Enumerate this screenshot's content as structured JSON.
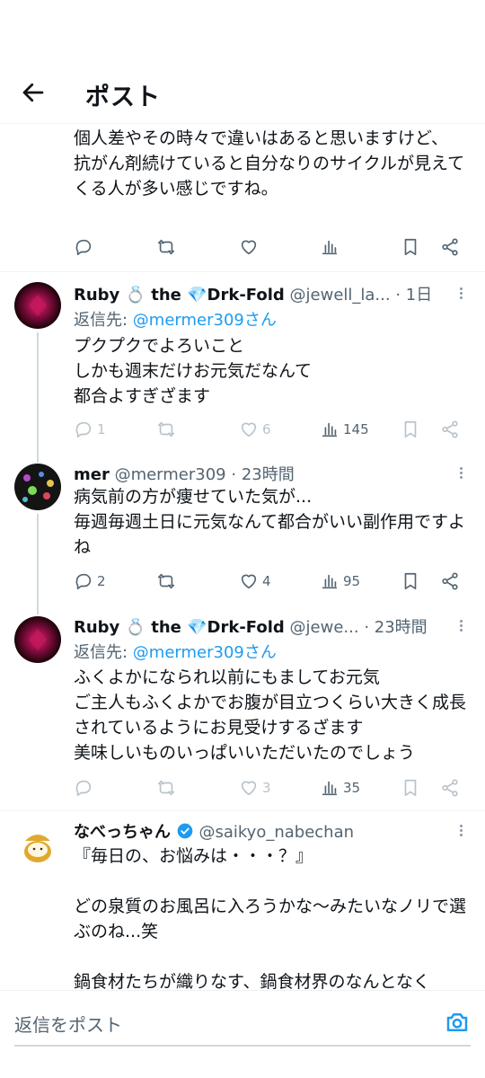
{
  "header": {
    "title": "ポスト"
  },
  "posts": [
    {
      "body": "個人差やその時々で違いはあると思いますけど、\n抗がん剤続けていると自分なりのサイクルが見えてくる人が多い感じですね。",
      "counts": {
        "reply": "",
        "repost": "",
        "like": "",
        "views": ""
      }
    },
    {
      "name": "Ruby 💍 the 💎Drk-Fold",
      "handle": "@jewell_la...",
      "time": "· 1日",
      "reply_prefix": "返信先: ",
      "reply_mention": "@mermer309さん",
      "body": "プクプクでよろいこと\nしかも週末だけお元気だなんて\n都合よすぎざます",
      "counts": {
        "reply": "1",
        "repost": "",
        "like": "6",
        "views": "145"
      }
    },
    {
      "name": "mer",
      "handle": "@mermer309",
      "time": "· 23時間",
      "body": "病気前の方が痩せていた気が...\n毎週毎週土日に元気なんて都合がいい副作用ですよね",
      "counts": {
        "reply": "2",
        "repost": "",
        "like": "4",
        "views": "95"
      }
    },
    {
      "name": "Ruby 💍 the 💎Drk-Fold",
      "handle": "@jewe...",
      "time": "· 23時間",
      "reply_prefix": "返信先: ",
      "reply_mention": "@mermer309さん",
      "body": "ふくよかになられ以前にもましてお元気\nご主人もふくよかでお腹が目立つくらい大きく成長されているようにお見受けするざます\n美味しいものいっぱいいただいたのでしょう",
      "counts": {
        "reply": "",
        "repost": "",
        "like": "3",
        "views": "35"
      }
    },
    {
      "name": "なべっちゃん",
      "handle": "@saikyo_nabechan",
      "body": "『毎日の、お悩みは・・・？』\n\nどの泉質のお風呂に入ろうかな〜みたいなノリで選ぶのね...笑\n\n鍋食材たちが織りなす、鍋食材界のなんとなく"
    }
  ],
  "composer": {
    "placeholder": "返信をポスト"
  },
  "colors": {
    "accent": "#1d9bf0",
    "secondary": "#536471",
    "verified": "#1d9bf0"
  }
}
